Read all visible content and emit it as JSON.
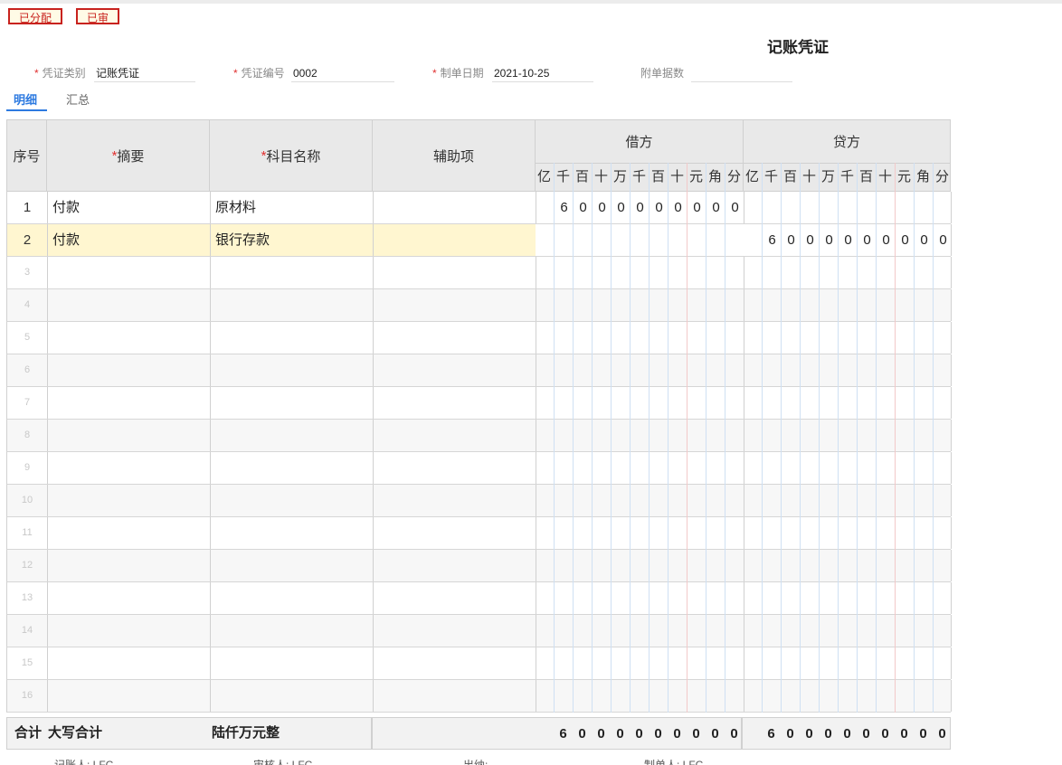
{
  "stamps": {
    "allocated": "已分配",
    "audited": "已审"
  },
  "voucher": {
    "title": "记账凭证",
    "type_label": "凭证类别",
    "type_value": "记账凭证",
    "number_label": "凭证编号",
    "number_value": "0002",
    "date_label": "制单日期",
    "date_value": "2021-10-25",
    "attachments_label": "附单据数",
    "attachments_value": ""
  },
  "tabs": {
    "detail": "明细",
    "summary": "汇总"
  },
  "table": {
    "headers": {
      "index": "序号",
      "summary": "摘要",
      "account": "科目名称",
      "aux": "辅助项",
      "debit": "借方",
      "credit": "贷方"
    },
    "digit_units": [
      "亿",
      "千",
      "百",
      "十",
      "万",
      "千",
      "百",
      "十",
      "元",
      "角",
      "分"
    ],
    "rows": [
      {
        "index": "1",
        "summary": "付款",
        "account": "原材料",
        "aux": "",
        "debit_digits": [
          "",
          "6",
          "0",
          "0",
          "0",
          "0",
          "0",
          "0",
          "0",
          "0",
          "0"
        ],
        "credit_digits": [
          "",
          "",
          "",
          "",
          "",
          "",
          "",
          "",
          "",
          "",
          ""
        ]
      },
      {
        "index": "2",
        "summary": "付款",
        "account": "银行存款",
        "aux": "",
        "debit_digits": [
          "",
          "",
          "",
          "",
          "",
          "",
          "",
          "",
          "",
          "",
          ""
        ],
        "credit_digits": [
          "",
          "6",
          "0",
          "0",
          "0",
          "0",
          "0",
          "0",
          "0",
          "0",
          "0"
        ]
      },
      {
        "index": "3"
      },
      {
        "index": "4"
      },
      {
        "index": "5"
      },
      {
        "index": "6"
      },
      {
        "index": "7"
      },
      {
        "index": "8"
      },
      {
        "index": "9"
      },
      {
        "index": "10"
      },
      {
        "index": "11"
      },
      {
        "index": "12"
      },
      {
        "index": "13"
      },
      {
        "index": "14"
      },
      {
        "index": "15"
      },
      {
        "index": "16"
      }
    ],
    "selected_row": 2
  },
  "totals": {
    "label": "合计",
    "words_label": "大写合计",
    "words_value": "陆仟万元整",
    "debit_digits": [
      "",
      "6",
      "0",
      "0",
      "0",
      "0",
      "0",
      "0",
      "0",
      "0",
      "0"
    ],
    "credit_digits": [
      "",
      "6",
      "0",
      "0",
      "0",
      "0",
      "0",
      "0",
      "0",
      "0",
      "0"
    ]
  },
  "signatures": {
    "bookkeeper": "记账人: LFC",
    "auditor": "审核人: LFC",
    "cashier": "出纳:",
    "preparer": "制单人: LFC"
  },
  "colors": {
    "accent": "#2d7ae0",
    "stamp": "#c8221e",
    "required": "#e03030",
    "selected_row": "#fff6d0"
  }
}
